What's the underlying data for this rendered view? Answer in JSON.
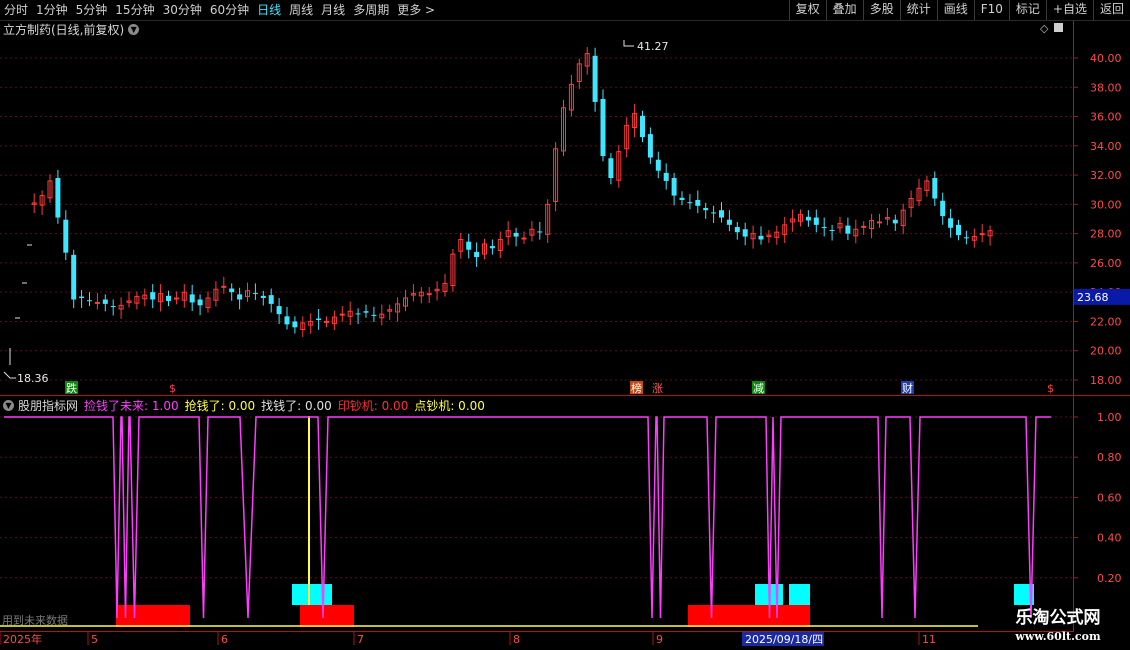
{
  "toolbar": {
    "periods": [
      "分时",
      "1分钟",
      "5分钟",
      "15分钟",
      "30分钟",
      "60分钟",
      "日线",
      "周线",
      "月线",
      "多周期",
      "更多 >"
    ],
    "active_index": 6,
    "buttons": [
      "复权",
      "叠加",
      "多股",
      "统计",
      "画线",
      "F10",
      "标记",
      "+自选",
      "返回"
    ]
  },
  "title": "立方制药(日线,前复权)",
  "indicator": {
    "name": "股朋指标网",
    "items": [
      {
        "label": "捡钱了未来: 1.00",
        "color": "#ff3cff"
      },
      {
        "label": "抢钱了: 0.00",
        "color": "#ffff40"
      },
      {
        "label": "找钱了: 0.00",
        "color": "#e0e0e0"
      },
      {
        "label": "印钞机: 0.00",
        "color": "#ff3030"
      },
      {
        "label": "点钞机: 0.00",
        "color": "#ffff40"
      }
    ],
    "future_note": "用到未来数据"
  },
  "watermark": {
    "name": "乐淘公式网",
    "url": "www.60lt.com"
  },
  "colors": {
    "up": "#ff3b3b",
    "down": "#3fe6ff",
    "axis": "#b01414",
    "grid": "#5a1010",
    "magenta": "#ff3cff",
    "yellow": "#ffff40",
    "red": "#ff0000",
    "cyan": "#00ffff"
  },
  "price_axis": {
    "ticks": [
      "40.00",
      "38.00",
      "36.00",
      "34.00",
      "32.00",
      "30.00",
      "28.00",
      "26.00",
      "24.00",
      "22.00",
      "20.00",
      "18.00"
    ],
    "current": "23.68",
    "max_label": "41.27",
    "min_label": "18.36"
  },
  "ind_axis": {
    "ticks": [
      "1.00",
      "0.80",
      "0.60",
      "0.40",
      "0.20"
    ]
  },
  "date_axis": {
    "labels": [
      "2025年",
      "5",
      "6",
      "7",
      "8",
      "9",
      "2025/09/18/四",
      "11"
    ]
  },
  "markers": [
    {
      "text": "跌",
      "bg": "#0a8a0a",
      "color": "#ffffff"
    },
    {
      "text": "$",
      "bg": "",
      "color": "#ff4040"
    },
    {
      "text": "榜",
      "bg": "#c04a10",
      "color": "#ffffff"
    },
    {
      "text": "涨",
      "bg": "",
      "color": "#ff6060"
    },
    {
      "text": "减",
      "bg": "#0a8a0a",
      "color": "#ffffff"
    },
    {
      "text": "财",
      "bg": "#1e3fae",
      "color": "#ffffff"
    },
    {
      "text": "$",
      "bg": "",
      "color": "#ff4040"
    }
  ]
}
